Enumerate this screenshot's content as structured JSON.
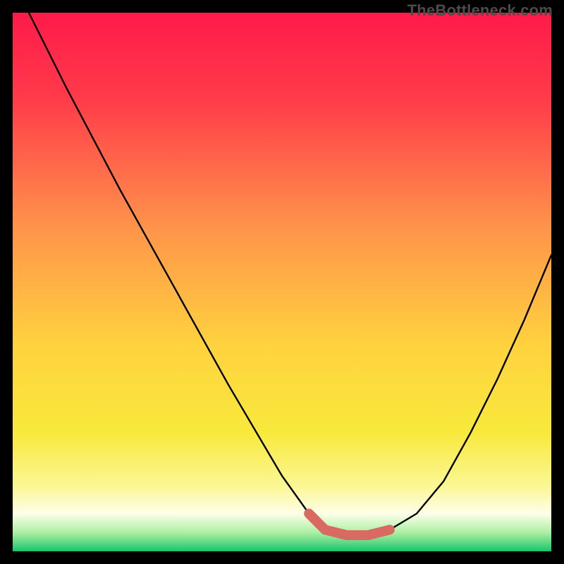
{
  "watermark": "TheBottleneck.com",
  "colors": {
    "emphasis": "#d96a61",
    "curve": "#000000",
    "gradient_stops": [
      {
        "offset": 0.0,
        "color": "#ff1a4a"
      },
      {
        "offset": 0.16,
        "color": "#ff3b49"
      },
      {
        "offset": 0.4,
        "color": "#ff944a"
      },
      {
        "offset": 0.62,
        "color": "#ffd33e"
      },
      {
        "offset": 0.78,
        "color": "#f8e93c"
      },
      {
        "offset": 0.88,
        "color": "#fbf796"
      },
      {
        "offset": 0.93,
        "color": "#fefee8"
      },
      {
        "offset": 0.965,
        "color": "#aef0a4"
      },
      {
        "offset": 1.0,
        "color": "#18c56a"
      }
    ]
  },
  "chart_data": {
    "type": "line",
    "title": "",
    "xlabel": "",
    "ylabel": "",
    "xlim": [
      0,
      100
    ],
    "ylim": [
      0,
      100
    ],
    "grid": false,
    "series": [
      {
        "name": "bottleneck-curve",
        "x": [
          3,
          10,
          20,
          30,
          40,
          50,
          55,
          58,
          62,
          66,
          70,
          75,
          80,
          85,
          90,
          95,
          100
        ],
        "y": [
          100,
          86,
          67,
          49,
          31,
          14,
          7,
          4,
          3,
          3,
          4,
          7,
          13,
          22,
          32,
          43,
          55
        ]
      }
    ],
    "emphasis_segment": {
      "name": "optimal-range",
      "x": [
        55,
        58,
        62,
        66,
        70
      ],
      "y": [
        7,
        4,
        3,
        3,
        4
      ]
    }
  }
}
